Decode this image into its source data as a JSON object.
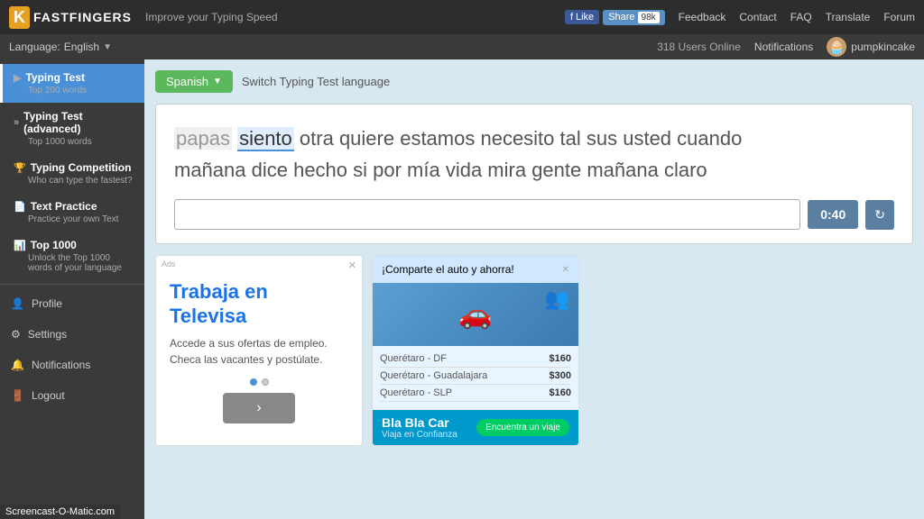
{
  "topbar": {
    "logo_k": "K",
    "logo_text": "FAST",
    "logo_text2": "FINGERS",
    "tagline": "Improve your Typing Speed",
    "fb_like": "Like",
    "share": "Share",
    "share_count": "98k",
    "links": [
      "Feedback",
      "Contact",
      "FAQ",
      "Translate",
      "Forum"
    ]
  },
  "subbar": {
    "language_label": "Language:",
    "language_value": "English",
    "users_online": "318 Users Online",
    "notifications": "Notifications",
    "username": "pumpkincake"
  },
  "sidebar": {
    "items": [
      {
        "id": "typing-test",
        "icon": "▶",
        "title": "Typing Test",
        "sub": "Top 200 words",
        "active": true
      },
      {
        "id": "typing-test-adv",
        "icon": "»",
        "title": "Typing Test (advanced)",
        "sub": "Top 1000 words",
        "active": false
      },
      {
        "id": "typing-comp",
        "icon": "🏆",
        "title": "Typing Competition",
        "sub": "Who can type the fastest?",
        "active": false
      },
      {
        "id": "text-practice",
        "icon": "📄",
        "title": "Text Practice",
        "sub": "Practice your own Text",
        "active": false
      },
      {
        "id": "top-1000",
        "icon": "📊",
        "title": "Top 1000",
        "sub": "Unlock the Top 1000 words of your language",
        "active": false
      }
    ],
    "simple_items": [
      {
        "id": "profile",
        "icon": "👤",
        "label": "Profile"
      },
      {
        "id": "settings",
        "icon": "⚙",
        "label": "Settings"
      },
      {
        "id": "notifications",
        "icon": "🔔",
        "label": "Notifications"
      },
      {
        "id": "logout",
        "icon": "🚪",
        "label": "Logout"
      }
    ]
  },
  "typing_area": {
    "lang_btn": "Spanish",
    "switch_label": "Switch Typing Test language",
    "text_line1": "papas siento otra quiere estamos necesito tal sus usted cuando",
    "text_line2": "mañana dice hecho si por mía vida mira gente mañana claro",
    "word_done": "papas",
    "word_current": "siento",
    "timer": "0:40",
    "input_placeholder": ""
  },
  "ads": {
    "left": {
      "title": "Trabaja en Televisa",
      "subtitle": "Accede a sus ofertas de empleo. Checa las vacantes y postúlate.",
      "label": "Ads"
    },
    "right": {
      "header": "¡Comparte el auto y ahorra!",
      "routes": [
        {
          "name": "Querétaro - DF",
          "price": "$160"
        },
        {
          "name": "Querétaro - Guadalajara",
          "price": "$300"
        },
        {
          "name": "Querétaro - SLP",
          "price": "$160"
        }
      ],
      "logo": "Bla Bla Car",
      "sub": "Viaja en Confianza",
      "find_btn": "Encuentra un viaje"
    }
  },
  "watermark": "Screencast-O-Matic.com"
}
